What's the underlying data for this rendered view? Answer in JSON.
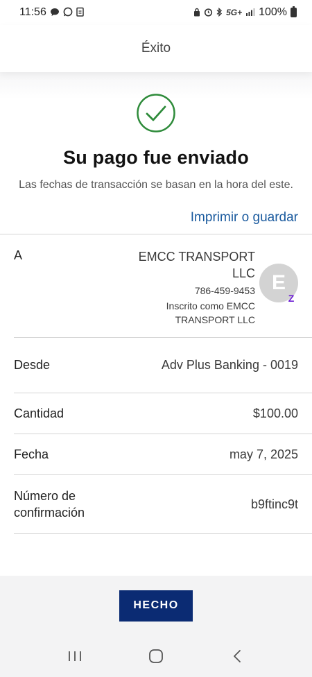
{
  "status_bar": {
    "time": "11:56",
    "network": "5G+",
    "battery": "100%"
  },
  "header": {
    "title": "Éxito"
  },
  "success": {
    "headline": "Su pago fue enviado",
    "subtext": "Las fechas de transacción se basan en la hora del este.",
    "icon": "check-circle-icon",
    "icon_color": "#2e8b3a"
  },
  "print_link": "Imprimir o guardar",
  "recipient": {
    "label": "A",
    "name": "EMCC TRANSPORT LLC",
    "phone": "786-459-9453",
    "enrolled": "Inscrito como EMCC TRANSPORT LLC",
    "avatar_letter": "E",
    "badge": "zelle-icon",
    "badge_glyph": "Z"
  },
  "details": [
    {
      "label": "Desde",
      "value": "Adv Plus Banking - 0019"
    },
    {
      "label": "Cantidad",
      "value": "$100.00"
    },
    {
      "label": "Fecha",
      "value": "may 7, 2025"
    },
    {
      "label": "Número de confirmación",
      "value": "b9ftinc9t"
    }
  ],
  "done_button": "HECHO",
  "colors": {
    "link": "#1a5a9e",
    "primary_button": "#0b2b73",
    "zelle": "#6d1ed4"
  },
  "nav": {
    "recents": "recent-apps-icon",
    "home": "home-icon",
    "back": "back-icon"
  }
}
